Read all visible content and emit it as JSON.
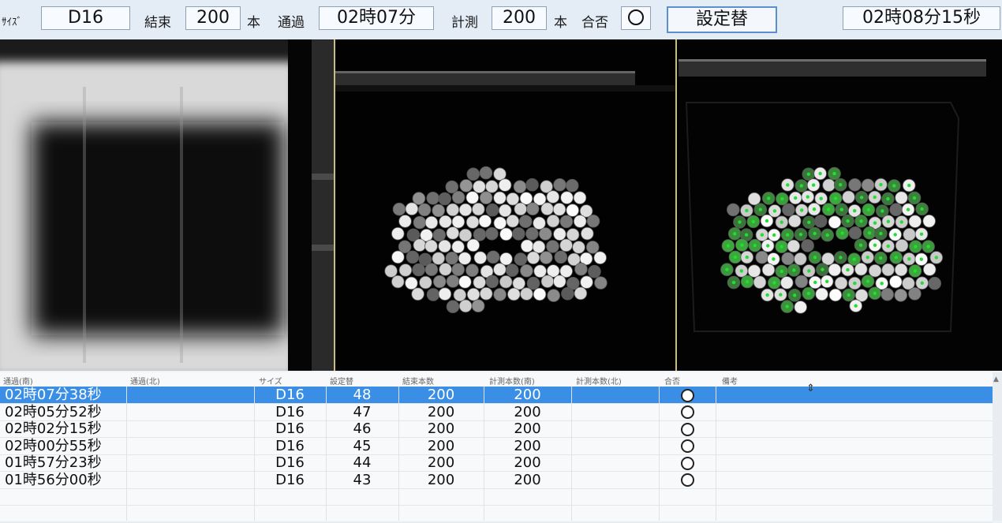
{
  "toolbar": {
    "size_label": "ｻｲｽﾞ",
    "size_value": "D16",
    "bundle_label": "結束",
    "bundle_value": "200",
    "bundle_unit": "本",
    "pass_label": "通過",
    "pass_value": "02時07分",
    "measure_label": "計測",
    "measure_value": "200",
    "measure_unit": "本",
    "pass_fail_label": "合否",
    "change_setting_button": "設定替",
    "clock": "02時08分15秒"
  },
  "table": {
    "headers": [
      "通過(南)",
      "通過(北)",
      "サイズ",
      "設定替",
      "結束本数",
      "計測本数(南)",
      "計測本数(北)",
      "合否",
      "備考"
    ],
    "rows": [
      {
        "pass_south": "02時07分38秒",
        "pass_north": "",
        "size": "D16",
        "setting": "48",
        "bundle": "200",
        "count_south": "200",
        "count_north": "",
        "result": "○",
        "note": ""
      },
      {
        "pass_south": "02時05分52秒",
        "pass_north": "",
        "size": "D16",
        "setting": "47",
        "bundle": "200",
        "count_south": "200",
        "count_north": "",
        "result": "○",
        "note": ""
      },
      {
        "pass_south": "02時02分15秒",
        "pass_north": "",
        "size": "D16",
        "setting": "46",
        "bundle": "200",
        "count_south": "200",
        "count_north": "",
        "result": "○",
        "note": ""
      },
      {
        "pass_south": "02時00分55秒",
        "pass_north": "",
        "size": "D16",
        "setting": "45",
        "bundle": "200",
        "count_south": "200",
        "count_north": "",
        "result": "○",
        "note": ""
      },
      {
        "pass_south": "01時57分23秒",
        "pass_north": "",
        "size": "D16",
        "setting": "44",
        "bundle": "200",
        "count_south": "200",
        "count_north": "",
        "result": "○",
        "note": ""
      },
      {
        "pass_south": "01時56分00秒",
        "pass_north": "",
        "size": "D16",
        "setting": "43",
        "bundle": "200",
        "count_south": "200",
        "count_north": "",
        "result": "○",
        "note": ""
      }
    ]
  },
  "colors": {
    "selected_row": "#3a8ee6",
    "detect_green": "#22dd33",
    "panel_divider": "#c9bd82"
  }
}
